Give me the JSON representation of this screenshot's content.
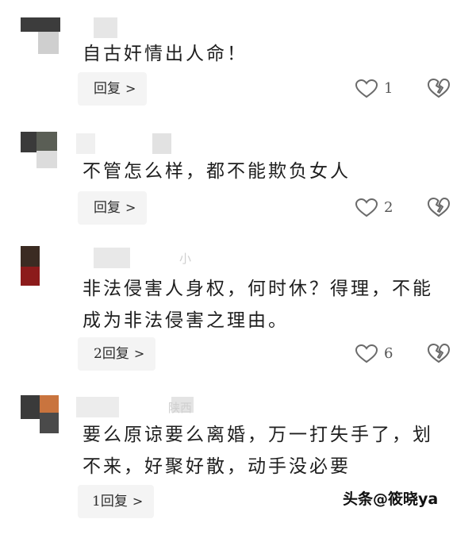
{
  "comments": [
    {
      "text": "自古奸情出人命！",
      "reply_label": "回复",
      "like_count": "1"
    },
    {
      "text": "不管怎么样，都不能欺负女人",
      "reply_label": "回复",
      "like_count": "2"
    },
    {
      "meta": "小",
      "text": "非法侵害人身权，何时休？得理，不能\n成为非法侵害之理由。",
      "reply_label": "2回复",
      "like_count": "6"
    },
    {
      "meta": "陕西",
      "text": "要么原谅要么离婚，万一打失手了，划\n不来，好聚好散，动手没必要",
      "reply_label": "1回复",
      "like_count": ""
    }
  ],
  "watermark": "头条@筱晓ya",
  "icons": {
    "like": "heart-outline-icon",
    "dislike": "broken-heart-icon",
    "chevron": "chevron-right-icon"
  },
  "colors": {
    "reply_bg": "#f4f4f4",
    "icon_stroke": "#6a6a6a"
  }
}
